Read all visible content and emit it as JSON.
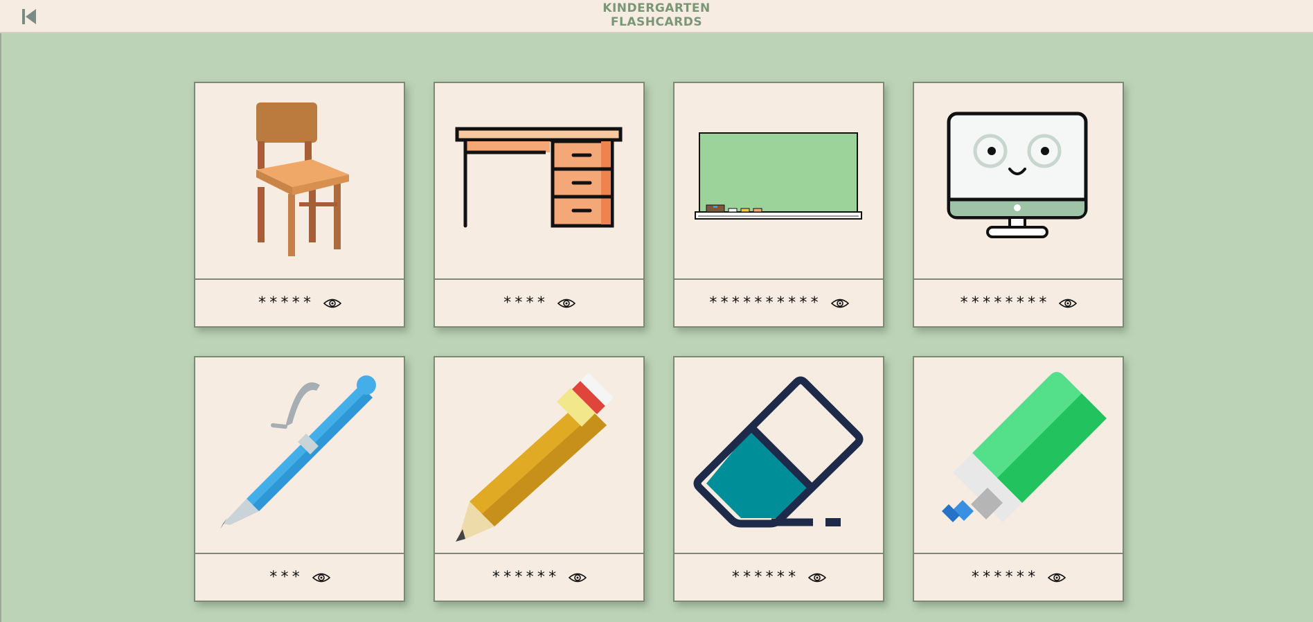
{
  "app": {
    "title_line1": "KINDERGARTEN",
    "title_line2": "FLASHCARDS"
  },
  "colors": {
    "background": "#bdd3b7",
    "card": "#f7ece2",
    "card_border": "#7a8a76",
    "title": "#7a9775"
  },
  "cards": [
    {
      "picture": "chair",
      "masked_word": "*****"
    },
    {
      "picture": "desk",
      "masked_word": "****"
    },
    {
      "picture": "chalkboard",
      "masked_word": "**********"
    },
    {
      "picture": "computer",
      "masked_word": "********"
    },
    {
      "picture": "pen",
      "masked_word": "***"
    },
    {
      "picture": "pencil",
      "masked_word": "******"
    },
    {
      "picture": "eraser",
      "masked_word": "******"
    },
    {
      "picture": "highlighter",
      "masked_word": "******"
    }
  ]
}
